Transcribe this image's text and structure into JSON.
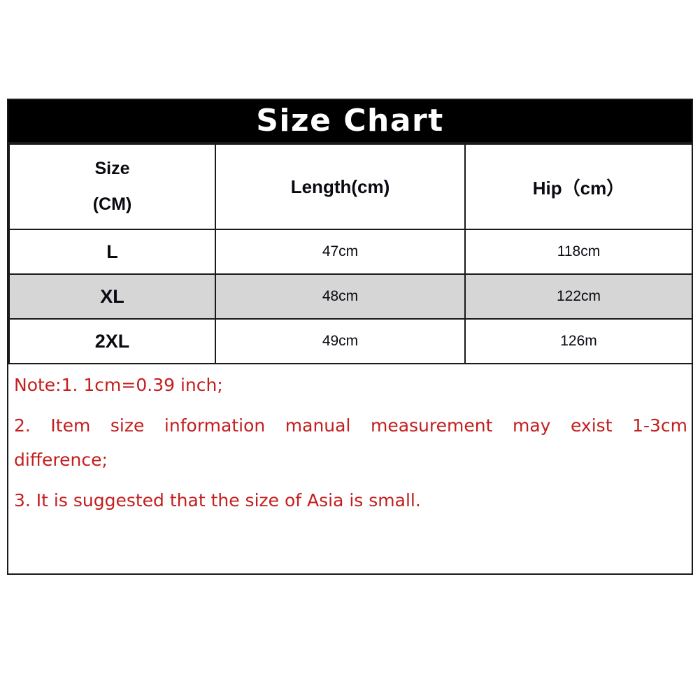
{
  "chart_data": {
    "type": "table",
    "title": "Size Chart",
    "columns": [
      "Size\n(CM)",
      "Length(cm)",
      "Hip（cm）"
    ],
    "rows": [
      [
        "L",
        "47cm",
        "118cm"
      ],
      [
        "XL",
        "48cm",
        "122cm"
      ],
      [
        "2XL",
        "49cm",
        "126m"
      ]
    ],
    "highlighted_row_index": 1,
    "notes": [
      "Note:1.  1cm=0.39 inch;",
      "2.  Item size information manual measurement may exist 1-3cm difference;",
      "3. It is suggested that the size of Asia is small."
    ]
  },
  "title": {
    "text": "Size Chart"
  },
  "table": {
    "headers": {
      "size_line1": "Size",
      "size_line2": "(CM)",
      "length": "Length(cm)",
      "hip": "Hip（cm）"
    },
    "rows": [
      {
        "size": "L",
        "length": "47cm",
        "hip": "118cm"
      },
      {
        "size": "XL",
        "length": "48cm",
        "hip": "122cm"
      },
      {
        "size": "2XL",
        "length": "49cm",
        "hip": "126m"
      }
    ]
  },
  "notes": {
    "line1": "Note:1.  1cm=0.39 inch;",
    "line2_justified": "2.  Item size information manual measurement may exist 1-3cm",
    "line2_cont": "difference;",
    "line3": "3. It is suggested that the size of Asia is small."
  },
  "colors": {
    "title_bar_background": "#000000",
    "title_text": "#ffffff",
    "border": "#1a1a1a",
    "note_text": "#c41e1e",
    "row_highlight": "#d6d6d6",
    "page_background": "#ffffff"
  }
}
